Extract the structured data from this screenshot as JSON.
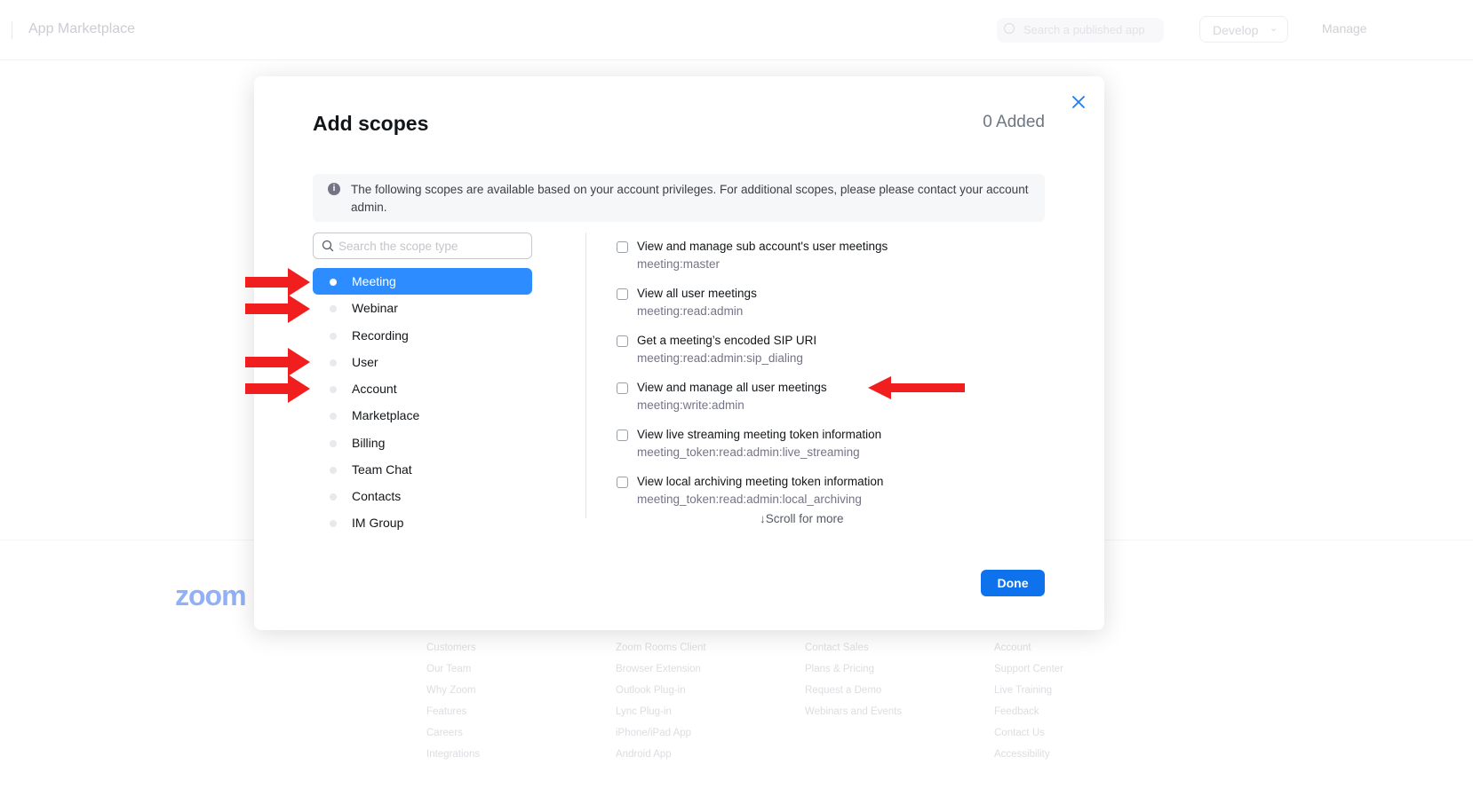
{
  "app": {
    "title": "App Marketplace",
    "search_placeholder": "Search a published app",
    "develop_label": "Develop",
    "manage_label": "Manage"
  },
  "footer": {
    "logo": "zoom",
    "col1": [
      "Customers",
      "Our Team",
      "Why Zoom",
      "Features",
      "Careers",
      "Integrations"
    ],
    "col2": [
      "Zoom Rooms Client",
      "Browser Extension",
      "Outlook Plug-in",
      "Lync Plug-in",
      "iPhone/iPad App",
      "Android App"
    ],
    "col3": [
      "Contact Sales",
      "Plans & Pricing",
      "Request a Demo",
      "Webinars and Events"
    ],
    "col4": [
      "Account",
      "Support Center",
      "Live Training",
      "Feedback",
      "Contact Us",
      "Accessibility"
    ]
  },
  "modal": {
    "title": "Add scopes",
    "added_count": "0 Added",
    "info_text": "The following scopes are available based on your account privileges. For additional scopes, please please contact your account admin.",
    "search_placeholder": "Search the scope type",
    "categories": [
      {
        "label": "Meeting",
        "active": true
      },
      {
        "label": "Webinar",
        "active": false
      },
      {
        "label": "Recording",
        "active": false
      },
      {
        "label": "User",
        "active": false
      },
      {
        "label": "Account",
        "active": false
      },
      {
        "label": "Marketplace",
        "active": false
      },
      {
        "label": "Billing",
        "active": false
      },
      {
        "label": "Team Chat",
        "active": false
      },
      {
        "label": "Contacts",
        "active": false
      },
      {
        "label": "IM Group",
        "active": false
      }
    ],
    "scopes": [
      {
        "name": "View and manage sub account's user meetings",
        "code": "meeting:master"
      },
      {
        "name": "View all user meetings",
        "code": "meeting:read:admin"
      },
      {
        "name": "Get a meeting’s encoded SIP URI",
        "code": "meeting:read:admin:sip_dialing"
      },
      {
        "name": "View and manage all user meetings",
        "code": "meeting:write:admin"
      },
      {
        "name": "View live streaming meeting token information",
        "code": "meeting_token:read:admin:live_streaming"
      },
      {
        "name": "View local archiving meeting token information",
        "code": "meeting_token:read:admin:local_archiving"
      }
    ],
    "scroll_hint": "↓Scroll for more",
    "done_label": "Done"
  },
  "colors": {
    "accent": "#0e72ed",
    "active_category": "#2d8cff",
    "annotation_arrow": "#f01e1e"
  }
}
